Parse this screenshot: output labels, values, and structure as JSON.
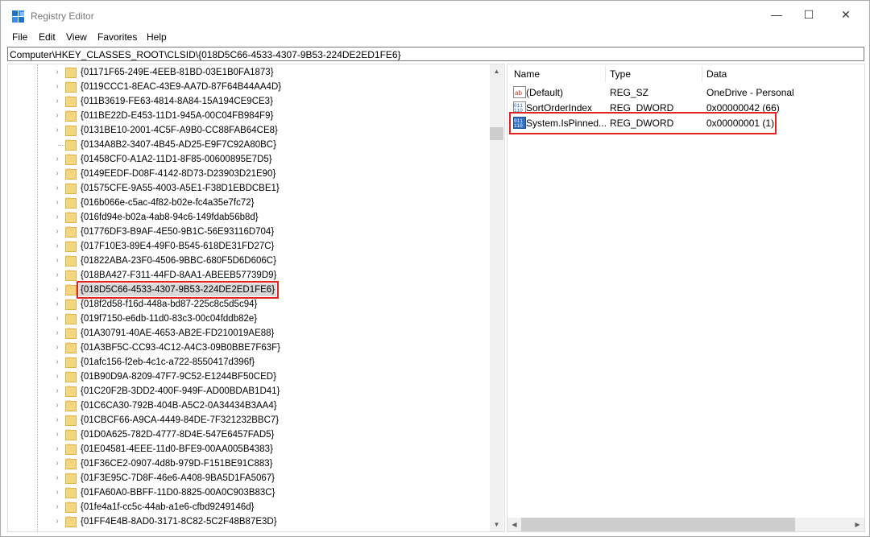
{
  "window": {
    "title": "Registry Editor",
    "minimize_glyph": "—",
    "maximize_glyph": "☐",
    "close_glyph": "✕"
  },
  "menu": [
    "File",
    "Edit",
    "View",
    "Favorites",
    "Help"
  ],
  "address": "Computer\\HKEY_CLASSES_ROOT\\CLSID\\{018D5C66-4533-4307-9B53-224DE2ED1FE6}",
  "tree": {
    "keys": [
      "{01171F65-249E-4EEB-81BD-03E1B0FA1873}",
      "{0119CCC1-8EAC-43E9-AA7D-87F64B44AA4D}",
      "{011B3619-FE63-4814-8A84-15A194CE9CE3}",
      "{011BE22D-E453-11D1-945A-00C04FB984F9}",
      "{0131BE10-2001-4C5F-A9B0-CC88FAB64CE8}",
      "{0134A8B2-3407-4B45-AD25-E9F7C92A80BC}",
      "{01458CF0-A1A2-11D1-8F85-00600895E7D5}",
      "{0149EEDF-D08F-4142-8D73-D23903D21E90}",
      "{01575CFE-9A55-4003-A5E1-F38D1EBDCBE1}",
      "{016b066e-c5ac-4f82-b02e-fc4a35e7fc72}",
      "{016fd94e-b02a-4ab8-94c6-149fdab56b8d}",
      "{01776DF3-B9AF-4E50-9B1C-56E93116D704}",
      "{017F10E3-89E4-49F0-B545-618DE31FD27C}",
      "{01822ABA-23F0-4506-9BBC-680F5D6D606C}",
      "{018BA427-F311-44FD-8AA1-ABEEB57739D9}",
      "{018D5C66-4533-4307-9B53-224DE2ED1FE6}",
      "{018f2d58-f16d-448a-bd87-225c8c5d5c94}",
      "{019f7150-e6db-11d0-83c3-00c04fddb82e}",
      "{01A30791-40AE-4653-AB2E-FD210019AE88}",
      "{01A3BF5C-CC93-4C12-A4C3-09B0BBE7F63F}",
      "{01afc156-f2eb-4c1c-a722-8550417d396f}",
      "{01B90D9A-8209-47F7-9C52-E1244BF50CED}",
      "{01C20F2B-3DD2-400F-949F-AD00BDAB1D41}",
      "{01C6CA30-792B-404B-A5C2-0A34434B3AA4}",
      "{01CBCF66-A9CA-4449-84DE-7F321232BBC7}",
      "{01D0A625-782D-4777-8D4E-547E6457FAD5}",
      "{01E04581-4EEE-11d0-BFE9-00AA005B4383}",
      "{01F36CE2-0907-4d8b-979D-F151BE91C883}",
      "{01F3E95C-7D8F-46e6-A408-9BA5D1FA5067}",
      "{01FA60A0-BBFF-11D0-8825-00A0C903B83C}",
      "{01fe4a1f-cc5c-44ab-a1e6-cfbd9249146d}",
      "{01FF4E4B-8AD0-3171-8C82-5C2F48B87E3D}"
    ],
    "expander_glyph": "›",
    "scroll_up_glyph": "▲",
    "scroll_down_glyph": "▼"
  },
  "values": {
    "headers": {
      "name": "Name",
      "type": "Type",
      "data": "Data"
    },
    "rows": [
      {
        "name": "(Default)",
        "type": "REG_SZ",
        "data": "OneDrive - Personal",
        "icon": "string-value-icon"
      },
      {
        "name": "SortOrderIndex",
        "type": "REG_DWORD",
        "data": "0x00000042 (66)",
        "icon": "dword-value-icon"
      },
      {
        "name": "System.IsPinned...",
        "type": "REG_DWORD",
        "data": "0x00000001 (1)",
        "icon": "dword-value-icon"
      }
    ],
    "scroll_left_glyph": "◀",
    "scroll_right_glyph": "▶"
  },
  "colors": {
    "highlight": "#e52222",
    "folder": "#f5d680",
    "selection": "#d9d9d9"
  }
}
